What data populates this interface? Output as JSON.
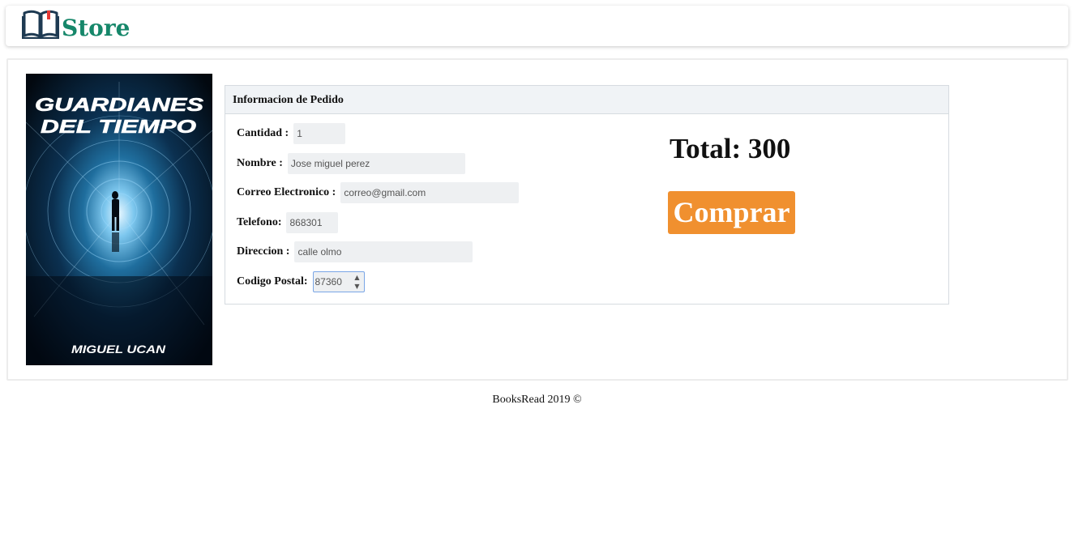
{
  "navbar": {
    "brand_text": "Store",
    "brand_icon": "open-book-icon",
    "brand_color": "#16876a"
  },
  "book": {
    "cover_title_line1": "GUARDIANES",
    "cover_title_line2": "DEL TIEMPO",
    "cover_author": "MIGUEL UCAN"
  },
  "order": {
    "header": "Informacion de Pedido",
    "fields": {
      "cantidad": {
        "label": "Cantidad :",
        "value": "1"
      },
      "nombre": {
        "label": "Nombre :",
        "value": "Jose miguel perez"
      },
      "correo": {
        "label": "Correo Electronico :",
        "value": "correo@gmail.com"
      },
      "telefono": {
        "label": "Telefono:",
        "value": "868301"
      },
      "direccion": {
        "label": "Direccion :",
        "value": "calle olmo"
      },
      "codigo_postal": {
        "label": "Codigo Postal:",
        "value": "87360"
      }
    },
    "total_text": "Total: 300",
    "buy_label": "Comprar",
    "buy_color": "#f0902f"
  },
  "footer": {
    "text": "BooksRead 2019 ©"
  }
}
